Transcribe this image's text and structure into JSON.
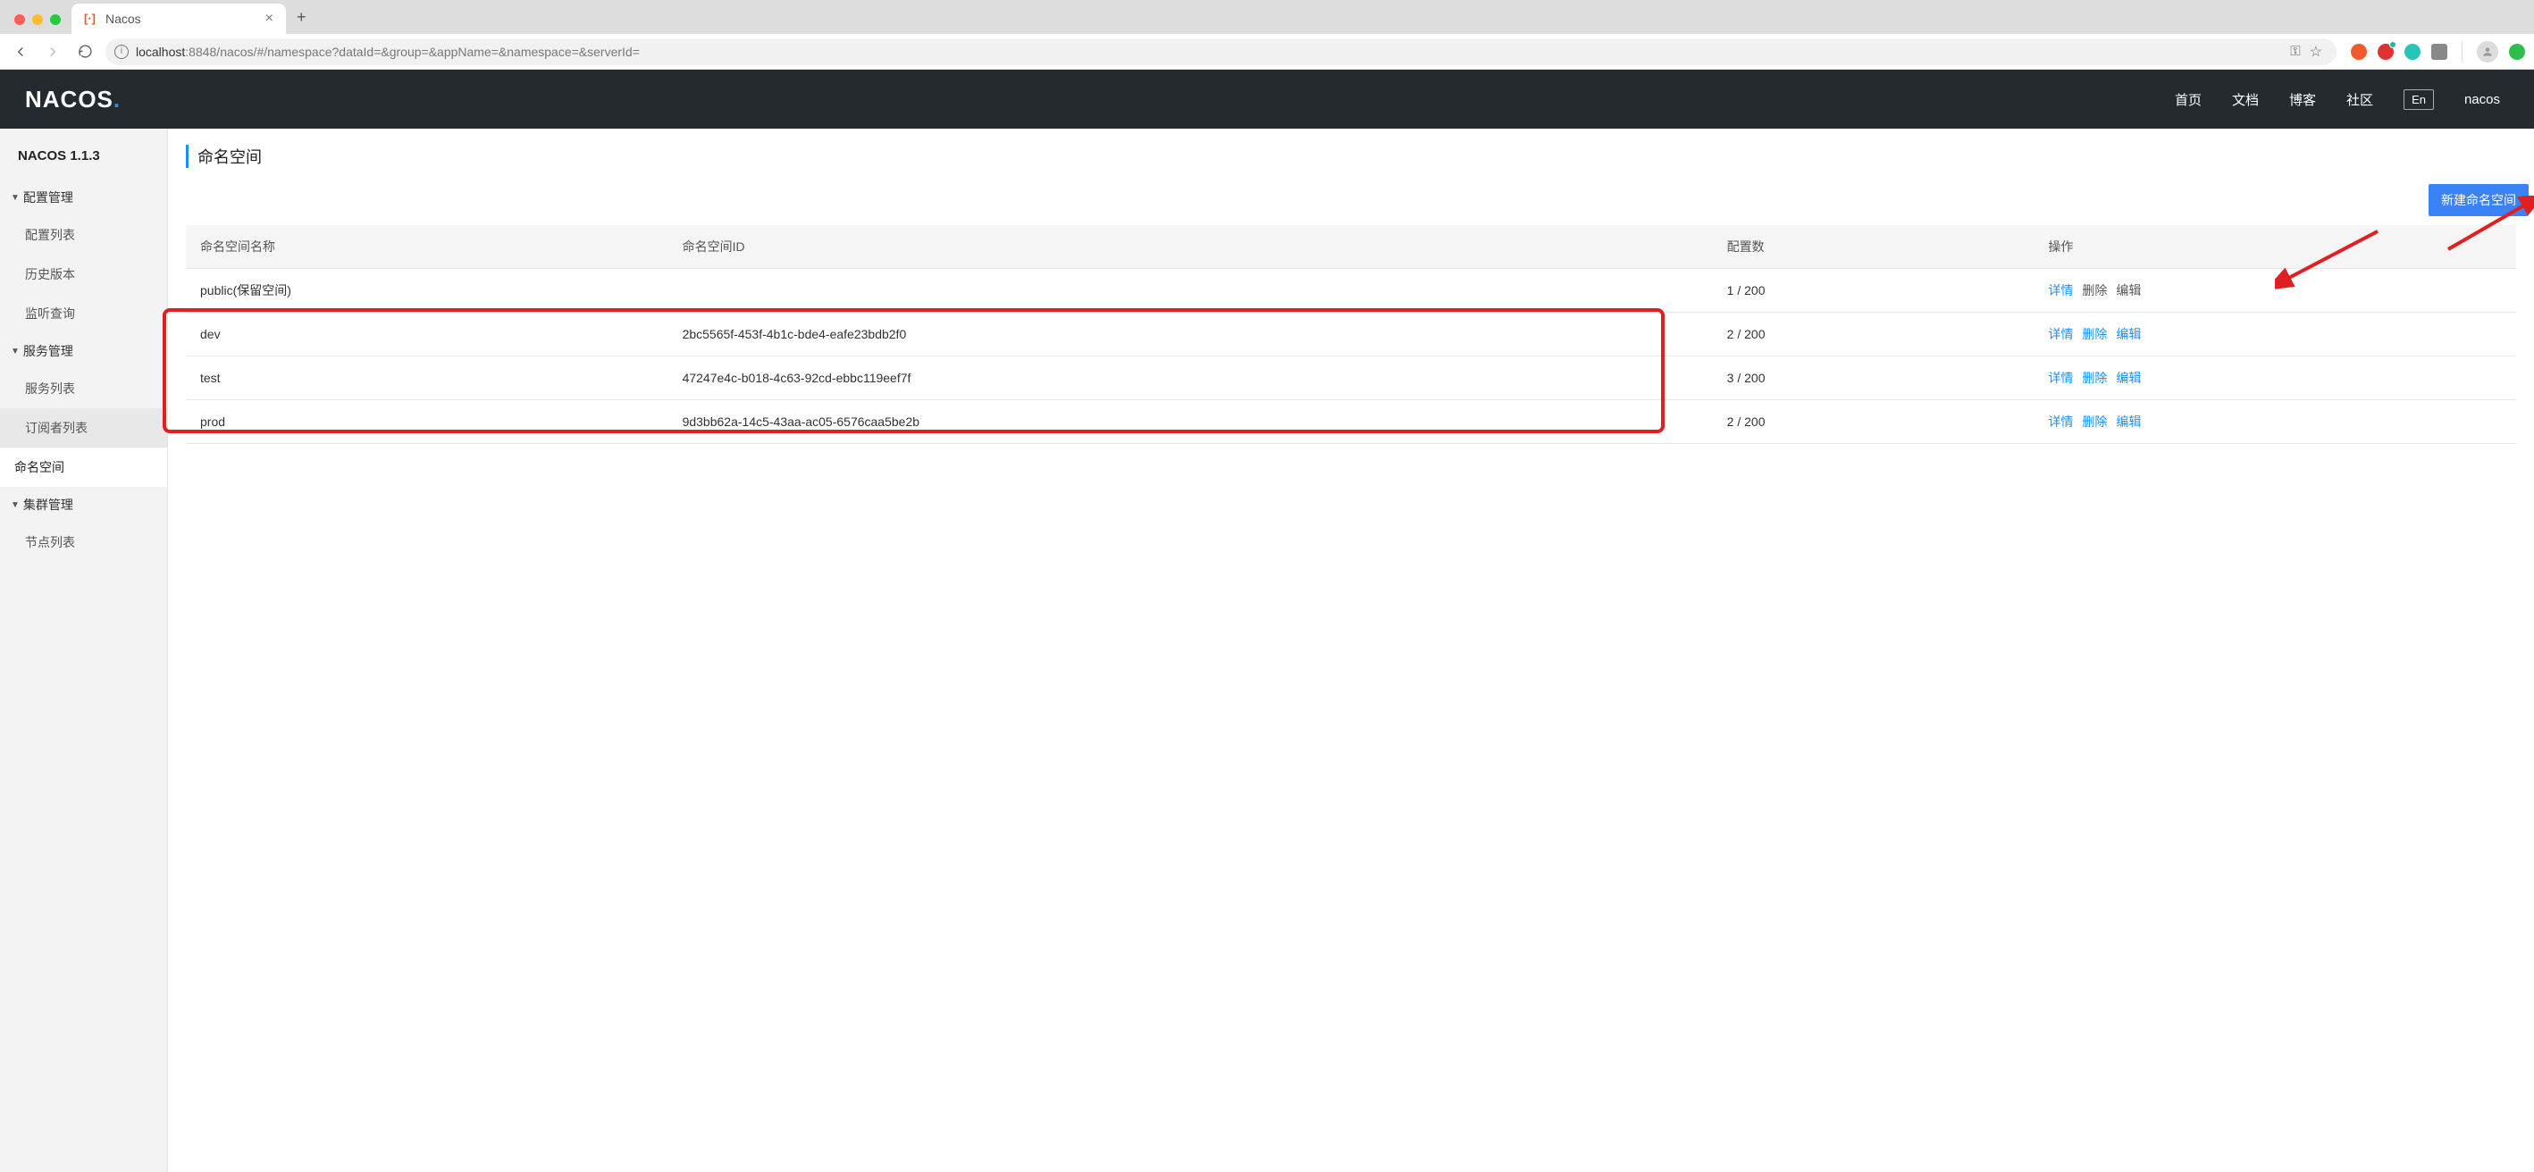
{
  "browser": {
    "tab_title": "Nacos",
    "url_host": "localhost",
    "url_port_path": ":8848/nacos/#/namespace?dataId=&group=&appName=&namespace=&serverId="
  },
  "header": {
    "logo_text": "NACOS",
    "nav": {
      "home": "首页",
      "docs": "文档",
      "blog": "博客",
      "community": "社区",
      "lang": "En",
      "user": "nacos"
    }
  },
  "sidebar": {
    "version": "NACOS 1.1.3",
    "groups": [
      {
        "title": "配置管理",
        "items": [
          "配置列表",
          "历史版本",
          "监听查询"
        ]
      },
      {
        "title": "服务管理",
        "items": [
          "服务列表",
          "订阅者列表"
        ]
      }
    ],
    "namespace_item": "命名空间",
    "cluster_group": {
      "title": "集群管理",
      "items": [
        "节点列表"
      ]
    }
  },
  "page": {
    "title": "命名空间",
    "create_btn": "新建命名空间",
    "cols": {
      "name": "命名空间名称",
      "id": "命名空间ID",
      "count": "配置数",
      "ops": "操作"
    },
    "ops_labels": {
      "detail": "详情",
      "delete": "删除",
      "edit": "编辑"
    },
    "rows": [
      {
        "name": "public(保留空间)",
        "id": "",
        "count": "1 / 200",
        "public": true
      },
      {
        "name": "dev",
        "id": "2bc5565f-453f-4b1c-bde4-eafe23bdb2f0",
        "count": "2 / 200",
        "public": false
      },
      {
        "name": "test",
        "id": "47247e4c-b018-4c63-92cd-ebbc119eef7f",
        "count": "3 / 200",
        "public": false
      },
      {
        "name": "prod",
        "id": "9d3bb62a-14c5-43aa-ac05-6576caa5be2b",
        "count": "2 / 200",
        "public": false
      }
    ]
  }
}
